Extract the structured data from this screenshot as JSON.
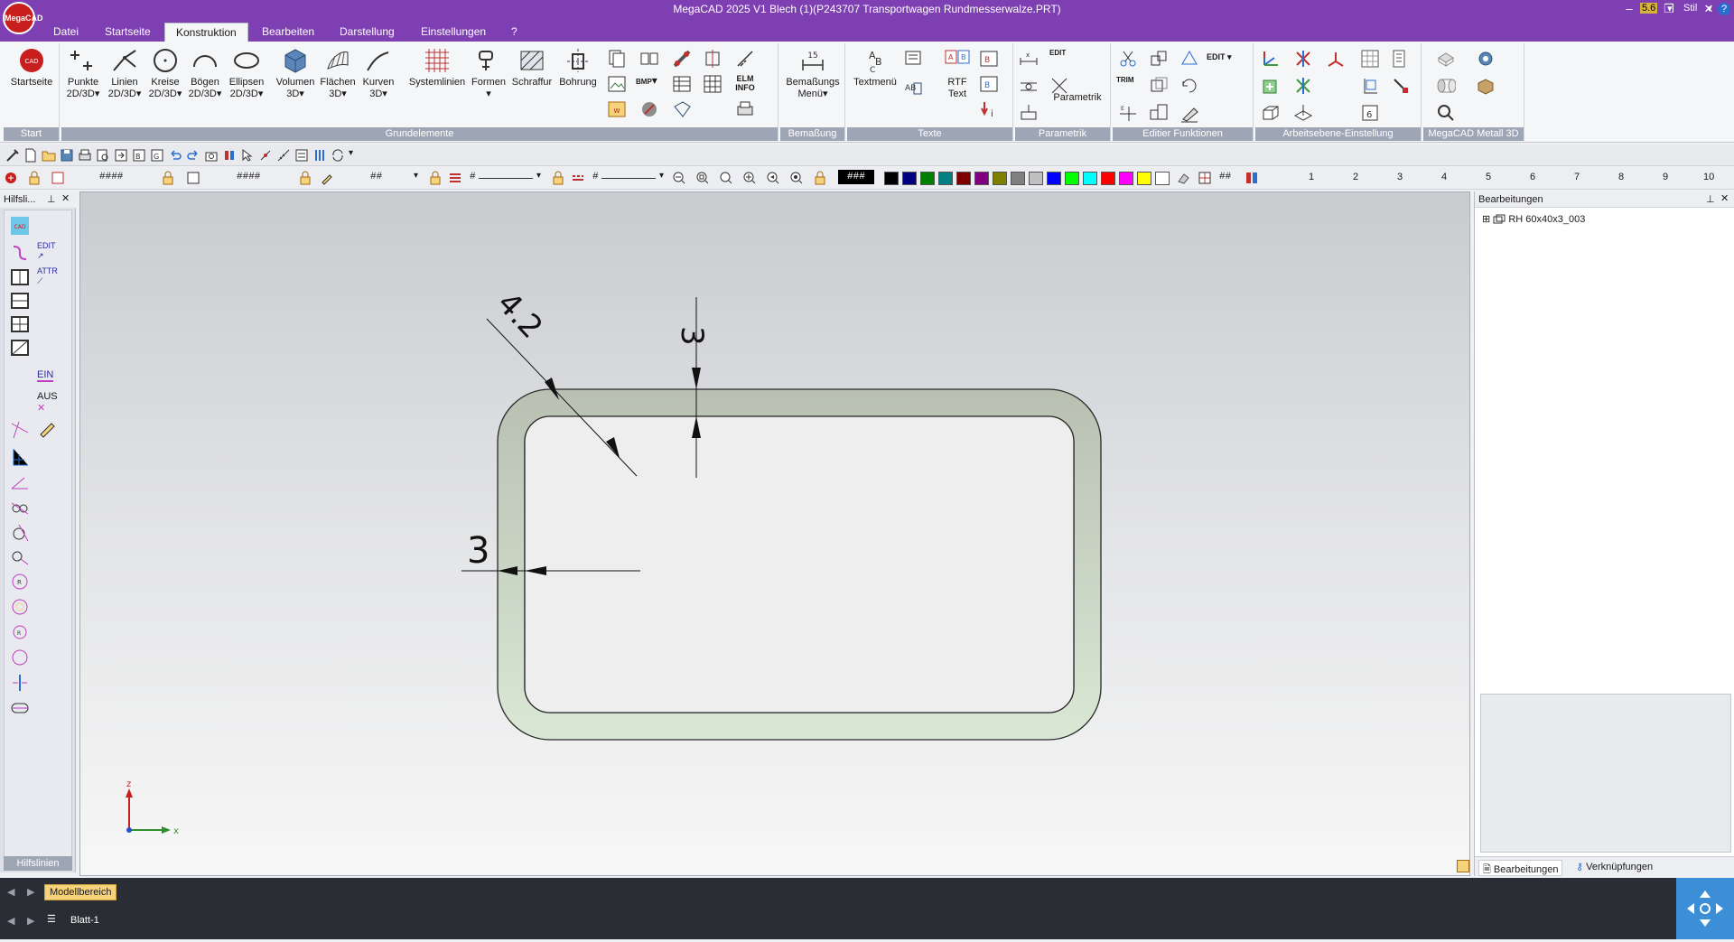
{
  "window": {
    "title": "MegaCAD 2025 V1 Blech (1)(P243707 Transportwagen Rundmesserwalze.PRT)",
    "logo_text": "MegaCAD",
    "style_label": "Stil",
    "quick_icon_label": "5.6"
  },
  "menu_tabs": [
    "Datei",
    "Startseite",
    "Konstruktion",
    "Bearbeiten",
    "Darstellung",
    "Einstellungen",
    "?"
  ],
  "active_tab": "Konstruktion",
  "ribbon": {
    "start": {
      "label": "Start",
      "button": "Startseite"
    },
    "grundelemente": {
      "label": "Grundelemente",
      "buttons": [
        {
          "line1": "Punkte",
          "line2": "2D/3D"
        },
        {
          "line1": "Linien",
          "line2": "2D/3D"
        },
        {
          "line1": "Kreise",
          "line2": "2D/3D"
        },
        {
          "line1": "Bögen",
          "line2": "2D/3D"
        },
        {
          "line1": "Ellipsen",
          "line2": "2D/3D"
        },
        {
          "line1": "Volumen",
          "line2": "3D"
        },
        {
          "line1": "Flächen",
          "line2": "3D"
        },
        {
          "line1": "Kurven",
          "line2": "3D"
        },
        {
          "line1": "Systemlinien",
          "line2": ""
        },
        {
          "line1": "Formen",
          "line2": ""
        },
        {
          "line1": "Schraffur",
          "line2": ""
        },
        {
          "line1": "Bohrung",
          "line2": ""
        }
      ],
      "elm_info": [
        "ELM",
        "INFO"
      ],
      "bmp_label": "BMP"
    },
    "bemassung": {
      "label": "Bemaßung",
      "button_line1": "Bemaßungs",
      "button_line2": "Menü",
      "icon_number": "15"
    },
    "texte": {
      "label": "Texte",
      "textmenu": "Textmenü",
      "rtf_line1": "RTF",
      "rtf_line2": "Text"
    },
    "parametrik": {
      "label": "Parametrik",
      "button": "Parametrik",
      "edit_label": "EDIT"
    },
    "editier": {
      "label": "Editier Funktionen",
      "edit_label": "EDIT",
      "trim_label": "TRIM"
    },
    "arbeitsebene": {
      "label": "Arbeitsebene-Einstellung"
    },
    "metall": {
      "label": "MegaCAD Metall 3D"
    }
  },
  "toolbar2": {
    "field1": "####",
    "field2": "####",
    "field3": "##",
    "field4": "#",
    "field5": "#",
    "field6": "###",
    "field7": "##",
    "colors": [
      "#000000",
      "#000080",
      "#008000",
      "#008080",
      "#800000",
      "#800080",
      "#808000",
      "#808080",
      "#c0c0c0",
      "#0000ff",
      "#00ff00",
      "#00ffff",
      "#ff0000",
      "#ff00ff",
      "#ffff00",
      "#ffffff"
    ],
    "layer_numbers": [
      "1",
      "2",
      "3",
      "4",
      "5",
      "6",
      "7",
      "8",
      "9",
      "10"
    ]
  },
  "left_panel": {
    "title": "Hilfsli...",
    "footer": "Hilfslinien",
    "ein_label": "EIN",
    "aus_label": "AUS",
    "edit_label": "EDIT",
    "attr_label": "ATTR"
  },
  "drawing": {
    "dim_diagonal": "4.2",
    "dim_top": "3",
    "dim_left": "3",
    "axis_z": "z",
    "axis_x": "x"
  },
  "right_panel": {
    "title": "Bearbeitungen",
    "tree_item": "RH 60x40x3_003",
    "tabs": [
      "Bearbeitungen",
      "Verknüpfungen"
    ]
  },
  "bottom": {
    "model_tab": "Modellbereich",
    "sheet_tab": "Blatt-1"
  }
}
